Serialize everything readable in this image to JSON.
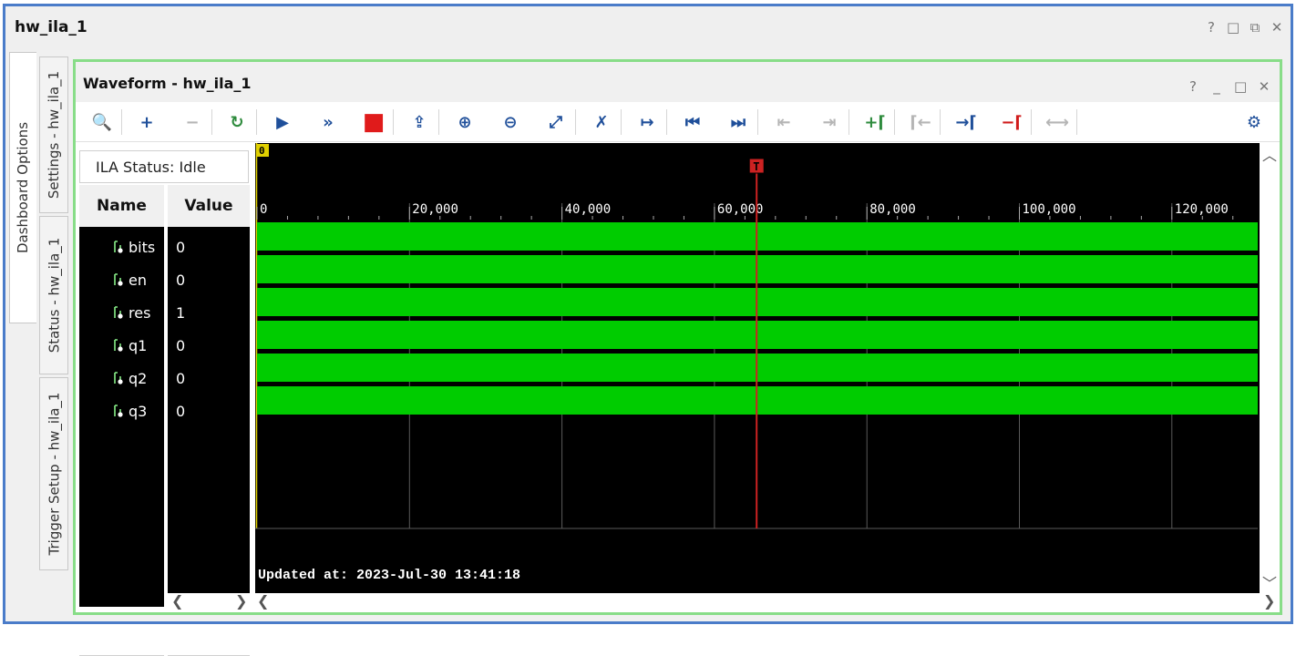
{
  "window": {
    "title": "hw_ila_1",
    "controls": [
      "?",
      "□",
      "⧉",
      "✕"
    ]
  },
  "side_tabs": [
    {
      "label": "Dashboard Options",
      "active": true
    },
    {
      "label": "Settings - hw_ila_1",
      "active": false
    },
    {
      "label": "Status - hw_ila_1",
      "active": false
    },
    {
      "label": "Trigger Setup - hw_ila_1",
      "active": false
    }
  ],
  "waveform": {
    "title": "Waveform - hw_ila_1",
    "controls": [
      "?",
      "_",
      "□",
      "✕"
    ],
    "ila_status": "ILA Status:  Idle",
    "columns": {
      "name": "Name",
      "value": "Value"
    },
    "signals": [
      {
        "name": "bits",
        "value": "0"
      },
      {
        "name": "en",
        "value": "0"
      },
      {
        "name": "res",
        "value": "1"
      },
      {
        "name": "q1",
        "value": "0"
      },
      {
        "name": "q2",
        "value": "0"
      },
      {
        "name": "q3",
        "value": "0"
      }
    ],
    "time_axis": {
      "labels": [
        "0",
        "20,000",
        "40,000",
        "60,000",
        "80,000",
        "100,000",
        "120,000"
      ],
      "max": 131072
    },
    "marker_label": "0",
    "trigger_label": "T",
    "trigger_sample": 65536,
    "updated_at": "Updated at: 2023-Jul-30 13:41:18",
    "colors": {
      "signal_bar": "#00cc00",
      "trigger_line": "#cc2222",
      "background": "#000000",
      "grid": "#5a5a5a",
      "marker_flag": "#e0d000"
    }
  },
  "toolbar": [
    {
      "icon": "search-zoom-icon",
      "glyph": "🔍",
      "enabled": true
    },
    {
      "icon": "add-icon",
      "glyph": "+",
      "enabled": true
    },
    {
      "icon": "remove-icon",
      "glyph": "−",
      "enabled": false
    },
    {
      "icon": "run-trigger-immediate-icon",
      "glyph": "↻",
      "enabled": true
    },
    {
      "icon": "run-trigger-icon",
      "glyph": "▶",
      "enabled": true
    },
    {
      "icon": "run-immediate-icon",
      "glyph": "»",
      "enabled": true
    },
    {
      "icon": "stop-icon",
      "glyph": "■",
      "enabled": true
    },
    {
      "icon": "export-icon",
      "glyph": "⇪",
      "enabled": true
    },
    {
      "icon": "zoom-in-icon",
      "glyph": "⊕",
      "enabled": true
    },
    {
      "icon": "zoom-out-icon",
      "glyph": "⊖",
      "enabled": true
    },
    {
      "icon": "zoom-fit-icon",
      "glyph": "⤢",
      "enabled": true
    },
    {
      "icon": "cursor-cross-icon",
      "glyph": "✗",
      "enabled": true
    },
    {
      "icon": "go-to-cursor-icon",
      "glyph": "↦",
      "enabled": true
    },
    {
      "icon": "go-to-start-icon",
      "glyph": "⏮",
      "enabled": true
    },
    {
      "icon": "go-to-end-icon",
      "glyph": "⏭",
      "enabled": true
    },
    {
      "icon": "previous-transition-icon",
      "glyph": "⇤",
      "enabled": false
    },
    {
      "icon": "next-transition-icon",
      "glyph": "⇥",
      "enabled": false
    },
    {
      "icon": "add-marker-icon",
      "glyph": "+⌈",
      "enabled": true
    },
    {
      "icon": "previous-marker-icon",
      "glyph": "⌈←",
      "enabled": false
    },
    {
      "icon": "next-marker-icon",
      "glyph": "→⌈",
      "enabled": true
    },
    {
      "icon": "delete-marker-icon",
      "glyph": "−⌈",
      "enabled": true
    },
    {
      "icon": "swap-markers-icon",
      "glyph": "⟷",
      "enabled": false
    },
    {
      "icon": "settings-gear-icon",
      "glyph": "⚙",
      "enabled": true
    }
  ]
}
